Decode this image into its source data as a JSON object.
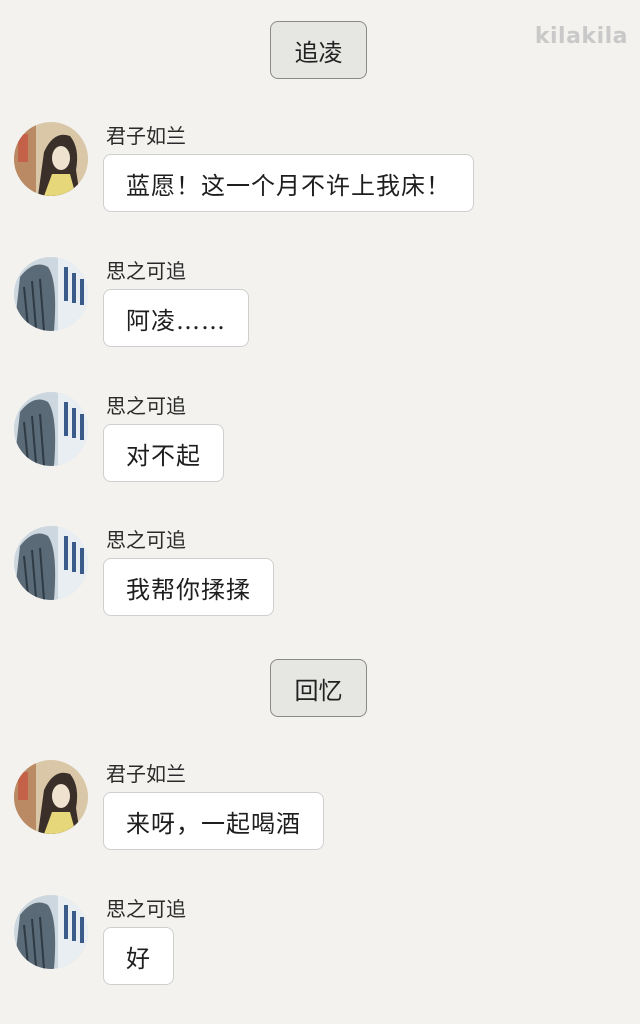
{
  "watermark": "kilakila",
  "sections": [
    {
      "label": "追凌"
    },
    {
      "label": "回忆"
    }
  ],
  "messages": [
    {
      "sender": "君子如兰",
      "text": "蓝愿！这一个月不许上我床！",
      "avatar": "jin-ling-avatar-icon"
    },
    {
      "sender": "思之可追",
      "text": "阿凌……",
      "avatar": "lan-sizhui-avatar-icon"
    },
    {
      "sender": "思之可追",
      "text": "对不起",
      "avatar": "lan-sizhui-avatar-icon"
    },
    {
      "sender": "思之可追",
      "text": "我帮你揉揉",
      "avatar": "lan-sizhui-avatar-icon"
    },
    {
      "sender": "君子如兰",
      "text": "来呀，一起喝酒",
      "avatar": "jin-ling-avatar-icon"
    },
    {
      "sender": "思之可追",
      "text": "好",
      "avatar": "lan-sizhui-avatar-icon"
    }
  ]
}
